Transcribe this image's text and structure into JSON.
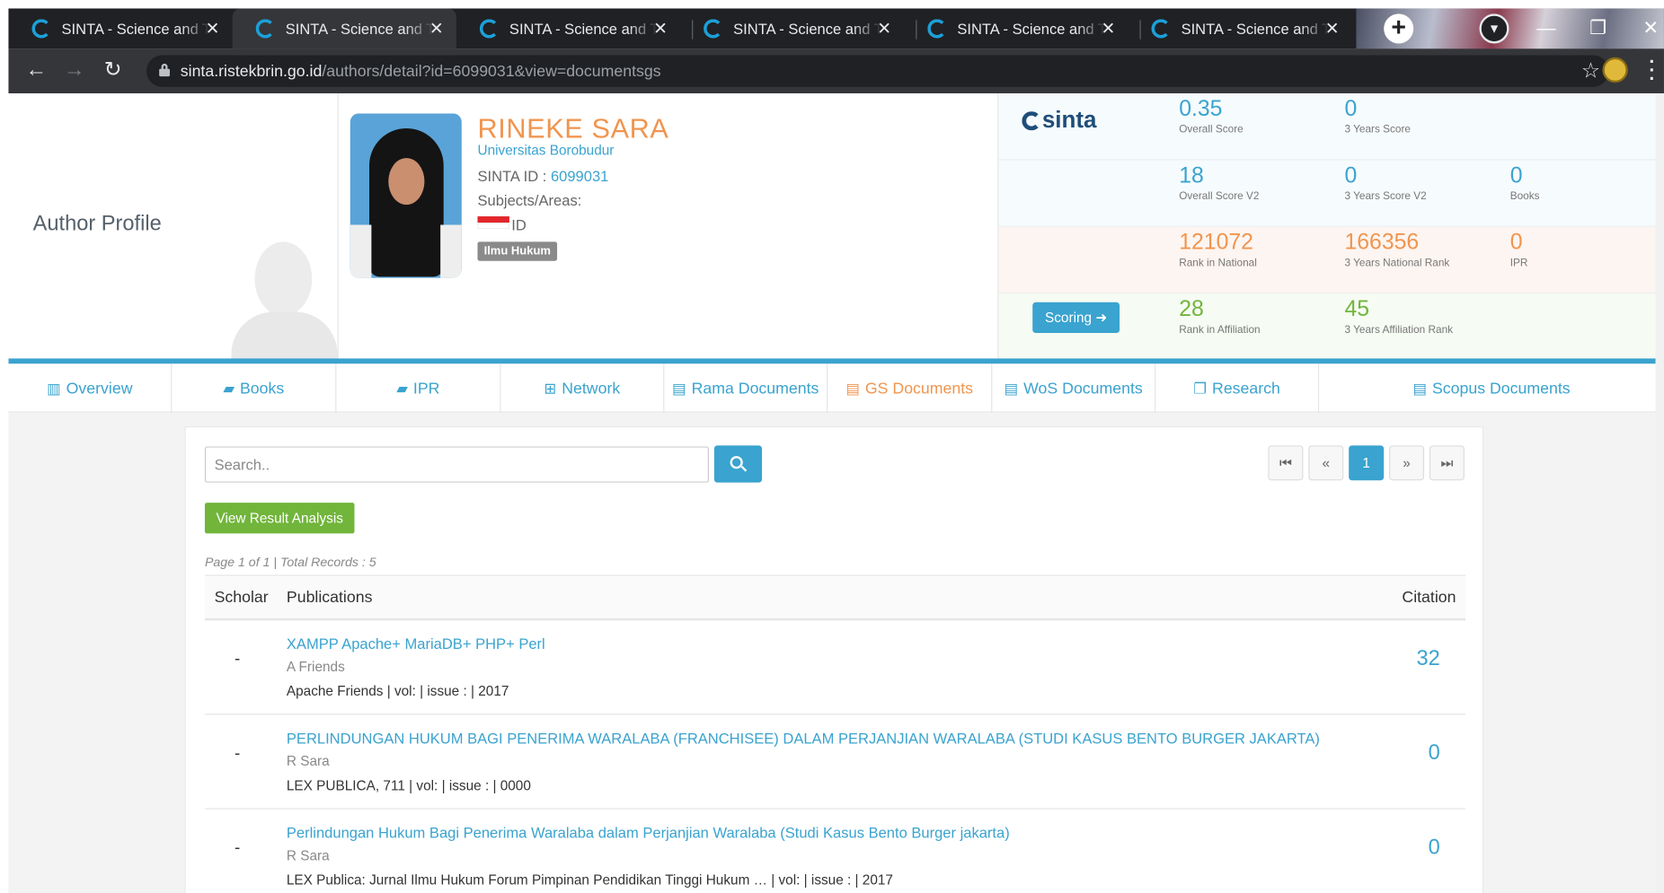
{
  "browser": {
    "tabs": [
      {
        "title": "SINTA - Science and Te",
        "active": false
      },
      {
        "title": "SINTA - Science and Te",
        "active": true
      },
      {
        "title": "SINTA - Science and Te",
        "active": false
      },
      {
        "title": "SINTA - Science and Te",
        "active": false
      },
      {
        "title": "SINTA - Science and Te",
        "active": false
      },
      {
        "title": "SINTA - Science and Te",
        "active": false
      }
    ],
    "url_host": "sinta.ristekbrin.go.id",
    "url_path": "/authors/detail?id=6099031&view=documentsgs"
  },
  "profile": {
    "section_title": "Author Profile",
    "name": "RINEKE SARA",
    "university": "Universitas Borobudur",
    "sinta_id_label": "SINTA ID : ",
    "sinta_id": "6099031",
    "subjects_label": "Subjects/Areas:",
    "country": "ID",
    "subject_badge": "Ilmu Hukum"
  },
  "scores": {
    "logo": "sinta",
    "scoring_button": "Scoring",
    "overall_score": {
      "value": "0.35",
      "label": "Overall Score"
    },
    "three_years_score": {
      "value": "0",
      "label": "3 Years Score"
    },
    "overall_score_v2": {
      "value": "18",
      "label": "Overall Score V2"
    },
    "three_years_score_v2": {
      "value": "0",
      "label": "3 Years Score V2"
    },
    "books": {
      "value": "0",
      "label": "Books"
    },
    "rank_national": {
      "value": "121072",
      "label": "Rank in National"
    },
    "three_years_national_rank": {
      "value": "166356",
      "label": "3 Years National Rank"
    },
    "ipr": {
      "value": "0",
      "label": "IPR"
    },
    "rank_affiliation": {
      "value": "28",
      "label": "Rank in Affiliation"
    },
    "three_years_affiliation_rank": {
      "value": "45",
      "label": "3 Years Affiliation Rank"
    }
  },
  "nav": [
    {
      "label": "Overview",
      "icon": "bar-chart-icon"
    },
    {
      "label": "Books",
      "icon": "book-icon"
    },
    {
      "label": "IPR",
      "icon": "book-icon"
    },
    {
      "label": "Network",
      "icon": "sitemap-icon"
    },
    {
      "label": "Rama Documents",
      "icon": "document-icon"
    },
    {
      "label": "GS Documents",
      "icon": "document-icon"
    },
    {
      "label": "WoS Documents",
      "icon": "document-icon"
    },
    {
      "label": "Research",
      "icon": "copy-icon"
    },
    {
      "label": "Scopus Documents",
      "icon": "document-icon"
    }
  ],
  "documents": {
    "search_placeholder": "Search..",
    "analysis_button": "View Result Analysis",
    "records_text": "Page 1 of 1 | Total Records : 5",
    "pagination": {
      "first": "⏮",
      "prev": "«",
      "current": "1",
      "next": "»",
      "last": "⏭"
    },
    "columns": {
      "scholar": "Scholar",
      "publications": "Publications",
      "citation": "Citation"
    },
    "rows": [
      {
        "scholar": "-",
        "title": "XAMPP Apache+ MariaDB+ PHP+ Perl",
        "authors": "A Friends",
        "venue": "Apache Friends | vol: | issue : | 2017",
        "citation": "32"
      },
      {
        "scholar": "-",
        "title": "PERLINDUNGAN HUKUM BAGI PENERIMA WARALABA (FRANCHISEE) DALAM PERJANJIAN WARALABA (STUDI KASUS BENTO BURGER JAKARTA)",
        "authors": "R Sara",
        "venue": "LEX PUBLICA, 711 | vol: | issue : | 0000",
        "citation": "0"
      },
      {
        "scholar": "-",
        "title": "Perlindungan Hukum Bagi Penerima Waralaba dalam Perjanjian Waralaba (Studi Kasus Bento Burger jakarta)",
        "authors": "R Sara",
        "venue": "LEX Publica: Jurnal Ilmu Hukum Forum Pimpinan Pendidikan Tinggi Hukum … | vol: | issue : | 2017",
        "citation": "0"
      }
    ]
  },
  "colors": {
    "accent_blue": "#3aa3cf",
    "accent_orange": "#f0954f",
    "accent_green": "#71b53b"
  }
}
